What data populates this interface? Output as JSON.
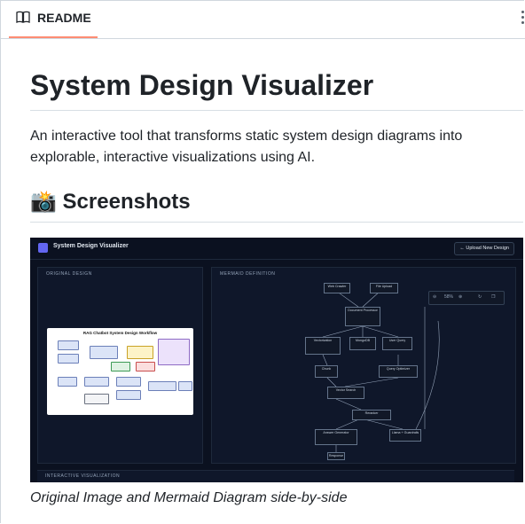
{
  "tab": {
    "label": "README",
    "icon": "book-icon"
  },
  "readme": {
    "title": "System Design Visualizer",
    "description": "An interactive tool that transforms static system design diagrams into explorable, interactive visualizations using AI.",
    "section_heading": "📸 Screenshots",
    "caption": "Original Image and Mermaid Diagram side-by-side"
  },
  "screenshot": {
    "app_title": "System Design Visualizer",
    "upload_button": "← Upload New Design",
    "panel_original": "ORIGINAL DESIGN",
    "panel_mermaid": "MERMAID DEFINITION",
    "panel_interactive": "INTERACTIVE VISUALIZATION",
    "original_diagram_title": "RAG Chatbot System Design Workflow",
    "zoom_level": "58%",
    "mermaid_nodes": [
      "Web Crawler",
      "File Upload",
      "Document Processor",
      "Vectorization",
      "MongoDB",
      "User Query",
      "Chunk",
      "Query Optimizer",
      "Vector Search",
      "Reranker",
      "Answer Generator",
      "Llama + Guardrails",
      "Response"
    ]
  },
  "colors": {
    "tab_accent": "#fd8c73",
    "app_bg": "#0b1120",
    "logo": "#6366f1"
  }
}
